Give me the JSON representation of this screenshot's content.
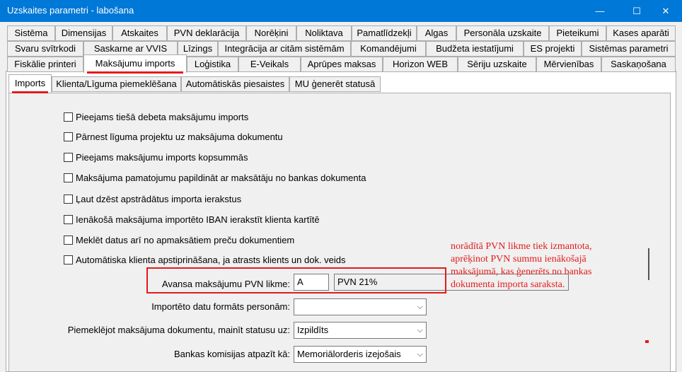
{
  "window": {
    "title": "Uzskaites parametri - labošana",
    "minimize": "—",
    "maximize": "☐",
    "close": "✕"
  },
  "tabs": {
    "row1": [
      "Sistēma",
      "Dimensijas",
      "Atskaites",
      "PVN deklarācija",
      "Norēķini",
      "Noliktava",
      "Pamatlīdzekļi",
      "Algas",
      "Personāla uzskaite",
      "Pieteikumi",
      "Kases aparāti"
    ],
    "row2": [
      "Svaru svītrkodi",
      "Saskarne ar VVIS",
      "Līzings",
      "Integrācija ar citām sistēmām",
      "Komandējumi",
      "Budžeta iestatījumi",
      "ES projekti",
      "Sistēmas parametri"
    ],
    "row3": [
      "Fiskālie printeri",
      "Maksājumu imports",
      "Loģistika",
      "E-Veikals",
      "Aprūpes maksas",
      "Horizon WEB",
      "Sēriju uzskaite",
      "Mērvienības",
      "Saskaņošana"
    ],
    "active": "Maksājumu imports"
  },
  "subtabs": {
    "items": [
      "Imports",
      "Klienta/Līguma piemeklēšana",
      "Automātiskās piesaistes",
      "MU ģenerēt statusā"
    ],
    "active": "Imports"
  },
  "checkboxes": [
    {
      "label": "Pieejams tiešā debeta maksājumu imports",
      "checked": false
    },
    {
      "label": "Pārnest līguma projektu uz maksājuma dokumentu",
      "checked": false
    },
    {
      "label": "Pieejams maksājumu imports kopsummās",
      "checked": false
    },
    {
      "label": "Maksājuma pamatojumu papildināt ar maksātāju no bankas dokumenta",
      "checked": false
    },
    {
      "label": "Ļaut dzēst apstrādātus importa ierakstus",
      "checked": false
    },
    {
      "label": "Ienākošā maksājuma importēto IBAN ierakstīt klienta kartītē",
      "checked": false
    },
    {
      "label": "Meklēt datus arī no apmaksātiem preču dokumentiem",
      "checked": false
    },
    {
      "label": "Automātiska klienta apstiprināšana, ja atrasts klients un dok. veids",
      "checked": false
    }
  ],
  "fields": {
    "vat_rate": {
      "label": "Avansa maksājumu PVN likme:",
      "code": "A",
      "description": "PVN 21%"
    },
    "person_format": {
      "label": "Importēto datu formāts personām:",
      "value": ""
    },
    "status_change": {
      "label": "Piemeklējot maksājuma dokumentu, mainīt statusu uz:",
      "value": "Izpildīts"
    },
    "bank_commission": {
      "label": "Bankas komisijas atpazīt kā:",
      "value": "Memoriālorderis izejošais"
    }
  },
  "annotation": {
    "text": "norādītā PVN likme tiek izmantota, aprēķinot PVN summu ienākošajā maksājumā, kas ģenerēts no bankas dokumenta importa saraksta.",
    "color": "#e31b1b"
  }
}
